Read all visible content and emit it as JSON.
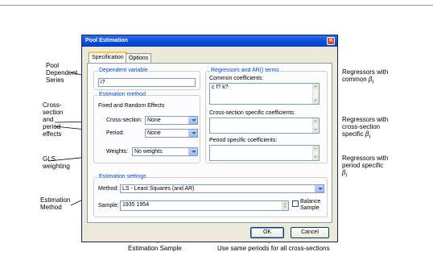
{
  "dialog": {
    "title": "Pool Estimation",
    "tabs": [
      "Specification",
      "Options"
    ]
  },
  "dependent": {
    "group_title": "Dependent variable",
    "value": "i?"
  },
  "estimation_method": {
    "group_title": "Estimation method",
    "fixed_random_label": "Fixed and Random Effects",
    "cross_section_label": "Cross-section:",
    "cross_section_value": "None",
    "period_label": "Period:",
    "period_value": "None",
    "weights_label": "Weights:",
    "weights_value": "No weights"
  },
  "regressors": {
    "group_title": "Regressors and AR() terms",
    "common_label": "Common coefficients:",
    "common_value": "c f? k?",
    "cross_specific_label": "Cross-section specific coefficients:",
    "cross_specific_value": "",
    "period_specific_label": "Period specific coefficients:",
    "period_specific_value": ""
  },
  "estimation_settings": {
    "group_title": "Estimation settings",
    "method_label": "Method:",
    "method_value": "LS  -  Least Squares (and AR)",
    "sample_label": "Sample:",
    "sample_value": "1935 1954",
    "balance_label_1": "Balance",
    "balance_label_2": "Sample",
    "balance_checked": false
  },
  "buttons": {
    "ok": "OK",
    "cancel": "Cancel"
  },
  "callouts": {
    "pool_dep": [
      "Pool",
      "Dependent",
      "Series"
    ],
    "cross_period": [
      "Cross-",
      "section",
      "and",
      "period",
      "effects"
    ],
    "gls": [
      "GLS",
      "weighting"
    ],
    "est_method": [
      "Estimation",
      "Method"
    ],
    "reg_common": [
      "Regressors with",
      "common"
    ],
    "reg_common_sym": "β",
    "reg_cross": [
      "Regressors with",
      "cross-section",
      "specific"
    ],
    "reg_cross_sym": "β",
    "reg_period": [
      "Regressors with",
      "period specific"
    ],
    "reg_period_sym": "β",
    "sym_sub": "i",
    "est_sample": "Estimation Sample",
    "same_periods": "Use same periods for all cross-sections"
  }
}
